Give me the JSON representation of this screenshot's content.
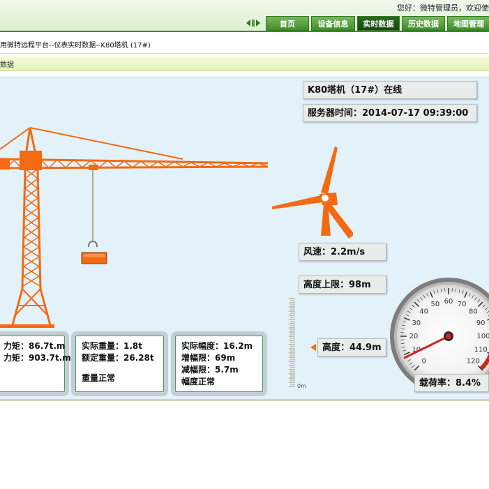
{
  "header": {
    "welcome": "您好：微特管理员，欢迎使",
    "nav_tabs": [
      {
        "label": "首页",
        "active": false
      },
      {
        "label": "设备信息",
        "active": false
      },
      {
        "label": "实时数据",
        "active": true
      },
      {
        "label": "历史数据",
        "active": false
      },
      {
        "label": "地图管理",
        "active": false
      }
    ]
  },
  "breadcrumb": "用微特远程平台--仪表实时数据--K80塔机 (17#)",
  "section_title": "数据",
  "status": {
    "device": "K80塔机（17#）在线",
    "server_time": "服务器时间：2014-07-17 09:39:00"
  },
  "wind": {
    "label": "风速：2.2m/s"
  },
  "height": {
    "upper_limit": "高度上限：98m",
    "current": "高度：44.9m",
    "scale_unit": "0m"
  },
  "gauge": {
    "ticks": [
      "0",
      "10",
      "20",
      "30",
      "40",
      "50",
      "60",
      "70",
      "80",
      "90",
      "100",
      "110",
      "120"
    ],
    "value": 8.4,
    "max": 120,
    "label": "载荷率：8.4%"
  },
  "cards": {
    "moment": {
      "line1": "力矩：86.7t.m",
      "line2": "力矩：903.7t.m"
    },
    "weight": {
      "actual": "实际重量：1.8t",
      "rated": "额定重量：26.28t",
      "status": "重量正常"
    },
    "range": {
      "actual": "实际幅度：16.2m",
      "inc_limit": "增幅限：69m",
      "dec_limit": "减幅限：5.7m",
      "status": "幅度正常"
    }
  },
  "colors": {
    "crane": "#f36a12",
    "nav_green": "#3f8c2a",
    "panel_bg": "#e3f1f8",
    "gauge_needle": "#d42020"
  }
}
